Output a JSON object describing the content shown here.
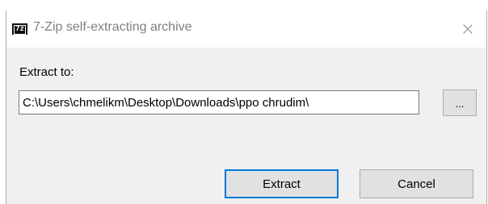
{
  "window": {
    "icon_text": "7z",
    "title": "7-Zip self-extracting archive",
    "close_glyph": "×"
  },
  "form": {
    "extract_label": "Extract to:",
    "path_value": "C:\\Users\\chmelikm\\Desktop\\Downloads\\ppo chrudim\\",
    "browse_label": "..."
  },
  "buttons": {
    "extract_label": "Extract",
    "cancel_label": "Cancel"
  },
  "colors": {
    "focus_accent": "#0078d7",
    "dialog_bg": "#f0f0f0"
  }
}
